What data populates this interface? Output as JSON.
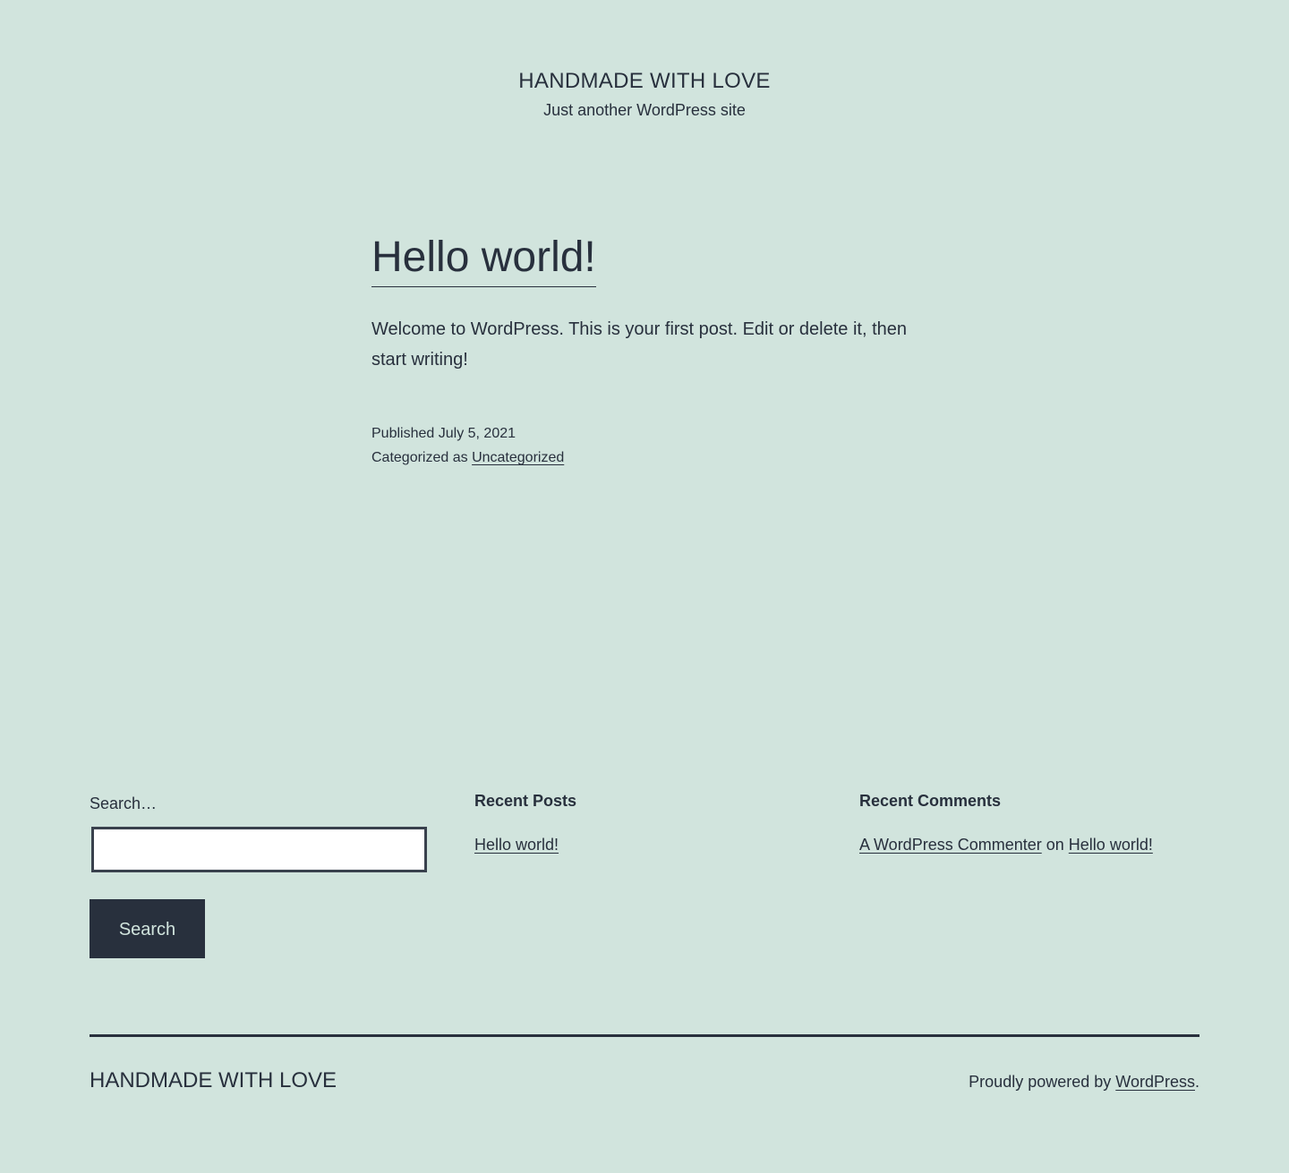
{
  "header": {
    "site_title": "HANDMADE WITH LOVE",
    "site_description": "Just another WordPress site"
  },
  "post": {
    "title": "Hello world!",
    "body": "Welcome to WordPress. This is your first post. Edit or delete it, then start writing!",
    "published_label": "Published",
    "published_date": "July 5, 2021",
    "categorized_label": "Categorized as",
    "category": "Uncategorized"
  },
  "widgets": {
    "search": {
      "label": "Search…",
      "value": "",
      "button_label": "Search"
    },
    "recent_posts": {
      "heading": "Recent Posts",
      "items": [
        "Hello world!"
      ]
    },
    "recent_comments": {
      "heading": "Recent Comments",
      "author": "A WordPress Commenter",
      "on_text": "on",
      "post": "Hello world!"
    }
  },
  "footer": {
    "site_title": "HANDMADE WITH LOVE",
    "powered_text": "Proudly powered by",
    "powered_link": "WordPress",
    "powered_suffix": "."
  }
}
